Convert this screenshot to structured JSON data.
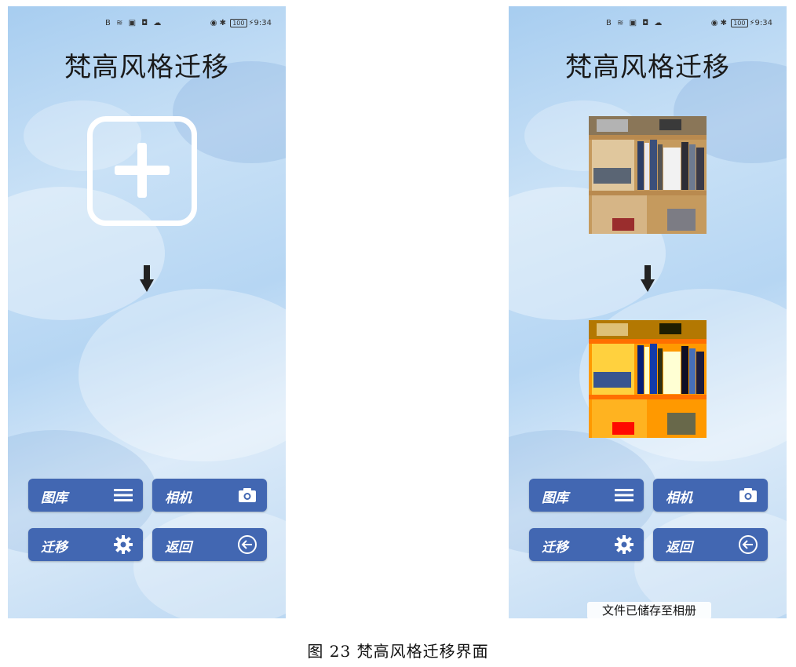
{
  "status_bar": {
    "left_icons": "B ≋ ▣ ◘ ☁",
    "battery": "100",
    "time": "9:34"
  },
  "left_screen": {
    "title": "梵高风格迁移",
    "buttons": {
      "gallery": "图库",
      "camera": "相机",
      "transfer": "迁移",
      "back": "返回"
    }
  },
  "right_screen": {
    "title": "梵高风格迁移",
    "buttons": {
      "gallery": "图库",
      "camera": "相机",
      "transfer": "迁移",
      "back": "返回"
    },
    "toast": "文件已储存至相册"
  },
  "caption": "图 23 梵高风格迁移界面",
  "colors": {
    "button_bg": "#4267b2",
    "background": "#bcd8f2"
  },
  "icons": [
    "menu-icon",
    "camera-icon",
    "gear-icon",
    "back-arrow-icon",
    "plus-icon",
    "down-arrow-icon"
  ]
}
